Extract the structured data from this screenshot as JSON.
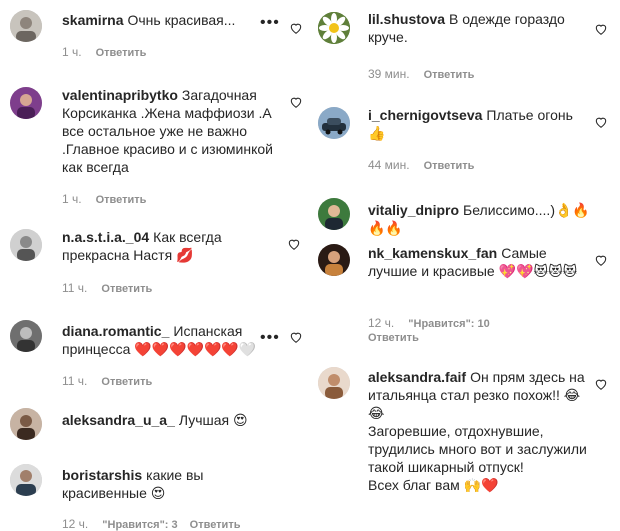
{
  "left": [
    {
      "username": "skamirna",
      "text": "Очнь красивая...",
      "time": "1 ч.",
      "reply": "Ответить"
    },
    {
      "username": "valentinapribytko",
      "text": "Загадочная Корсиканка .Жена маффиози .А все остальное уже не важно .Главное красиво и с изюминкой как всегда",
      "time": "1 ч.",
      "reply": "Ответить"
    },
    {
      "username": "n.a.s.t.i.a._04",
      "text": "Как всегда прекрасна Настя",
      "emoji": "💋",
      "time": "11 ч.",
      "reply": "Ответить"
    },
    {
      "username": "diana.romantic_",
      "text": "Испанская принцесса",
      "emoji": "❤️❤️❤️❤️❤️❤️🤍",
      "time": "11 ч.",
      "reply": "Ответить"
    },
    {
      "username": "aleksandra_u_a_",
      "text": "Лучшая",
      "emoji": "😍"
    },
    {
      "username": "boristarshis",
      "text": "какие вы красивенные",
      "emoji": "😍",
      "time": "12 ч.",
      "likes": "\"Нравится\": 3",
      "reply": "Ответить"
    }
  ],
  "right": [
    {
      "username": "lil.shustova",
      "text": "В одежде гораздо круче.",
      "time": "39 мин.",
      "reply": "Ответить"
    },
    {
      "username": "i_chernigovtseva",
      "text": "Платье огонь",
      "emoji": "👍",
      "time": "44 мин.",
      "reply": "Ответить"
    },
    {
      "username": "vitaliy_dnipro",
      "text": "Белиссимо....)",
      "emoji": "👌🔥🔥🔥"
    },
    {
      "username": "nk_kamenskux_fan",
      "text": "Самые лучшие и красивые",
      "emoji": "💖💖😻😻😻",
      "time": "12 ч.",
      "likes": "\"Нравится\": 10",
      "reply": "Ответить"
    },
    {
      "username": "aleksandra.faif",
      "text": "Он прям здесь на итальянца стал резко похож!!",
      "emoji": "😂😂",
      "text2": "Загоревшие, отдохнувшие, трудились много вот и заслужили такой шикарный отпуск!",
      "text3": "Всех благ вам",
      "emoji3": "🙌❤️"
    }
  ]
}
